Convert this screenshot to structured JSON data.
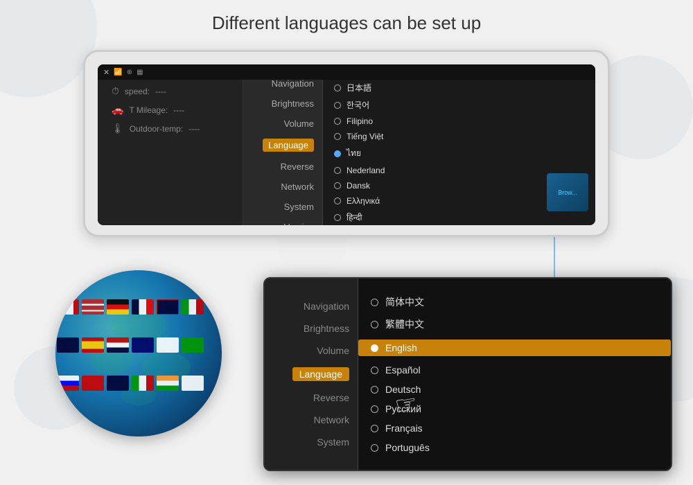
{
  "page": {
    "title": "Different languages can be set up",
    "bg_color": "#f0f0f0"
  },
  "top_device": {
    "status_bar": {
      "close": "✕",
      "wifi": "📶",
      "bt": "⊕",
      "signal": "▦"
    },
    "left_panel": {
      "speed_label": "speed:",
      "speed_value": "----",
      "mileage_label": "T Mileage:",
      "mileage_value": "----",
      "temp_label": "Outdoor-temp:",
      "temp_value": "----"
    },
    "menu_items": [
      {
        "label": "Navigation",
        "active": false
      },
      {
        "label": "Brightness",
        "active": false
      },
      {
        "label": "Volume",
        "active": false
      },
      {
        "label": "Language",
        "active": true
      },
      {
        "label": "Reverse",
        "active": false
      },
      {
        "label": "Network",
        "active": false
      },
      {
        "label": "System",
        "active": false
      },
      {
        "label": "Version",
        "active": false
      }
    ],
    "languages": [
      {
        "label": "日本語",
        "selected": false
      },
      {
        "label": "한국어",
        "selected": false
      },
      {
        "label": "Filipino",
        "selected": false
      },
      {
        "label": "Tiếng Việt",
        "selected": false
      },
      {
        "label": "ไทย",
        "selected": true
      },
      {
        "label": "Nederland",
        "selected": false
      },
      {
        "label": "Dansk",
        "selected": false
      },
      {
        "label": "Ελληνικά",
        "selected": false
      },
      {
        "label": "हिन्दी",
        "selected": false
      }
    ]
  },
  "bottom_panel": {
    "menu_items": [
      {
        "label": "Navigation",
        "active": false
      },
      {
        "label": "Brightness",
        "active": false
      },
      {
        "label": "Volume",
        "active": false
      },
      {
        "label": "Language",
        "active": true
      },
      {
        "label": "Reverse",
        "active": false
      },
      {
        "label": "Network",
        "active": false
      },
      {
        "label": "System",
        "active": false
      }
    ],
    "languages": [
      {
        "label": "简体中文",
        "selected": false
      },
      {
        "label": "繁體中文",
        "selected": false
      },
      {
        "label": "English",
        "selected": true
      },
      {
        "label": "Español",
        "selected": false
      },
      {
        "label": "Deutsch",
        "selected": false
      },
      {
        "label": "Русский",
        "selected": false
      },
      {
        "label": "Français",
        "selected": false
      },
      {
        "label": "Português",
        "selected": false
      }
    ]
  },
  "flags": [
    {
      "color": "#e03",
      "stripe": "#fff"
    },
    {
      "color": "#003",
      "stripe": "#e03"
    },
    {
      "color": "#e80",
      "stripe": "#000"
    },
    {
      "color": "#006",
      "stripe": "#fff"
    },
    {
      "color": "#c00",
      "stripe": "#fff"
    },
    {
      "color": "#003",
      "stripe": "#fc0"
    },
    {
      "color": "#090",
      "stripe": "#fff"
    },
    {
      "color": "#e03",
      "stripe": "#00c"
    }
  ],
  "colors": {
    "accent_orange": "#c8820a",
    "active_blue": "#5af",
    "bg_dark": "#1a1a1a",
    "bg_mid": "#222",
    "text_muted": "#888",
    "text_light": "#ddd"
  }
}
